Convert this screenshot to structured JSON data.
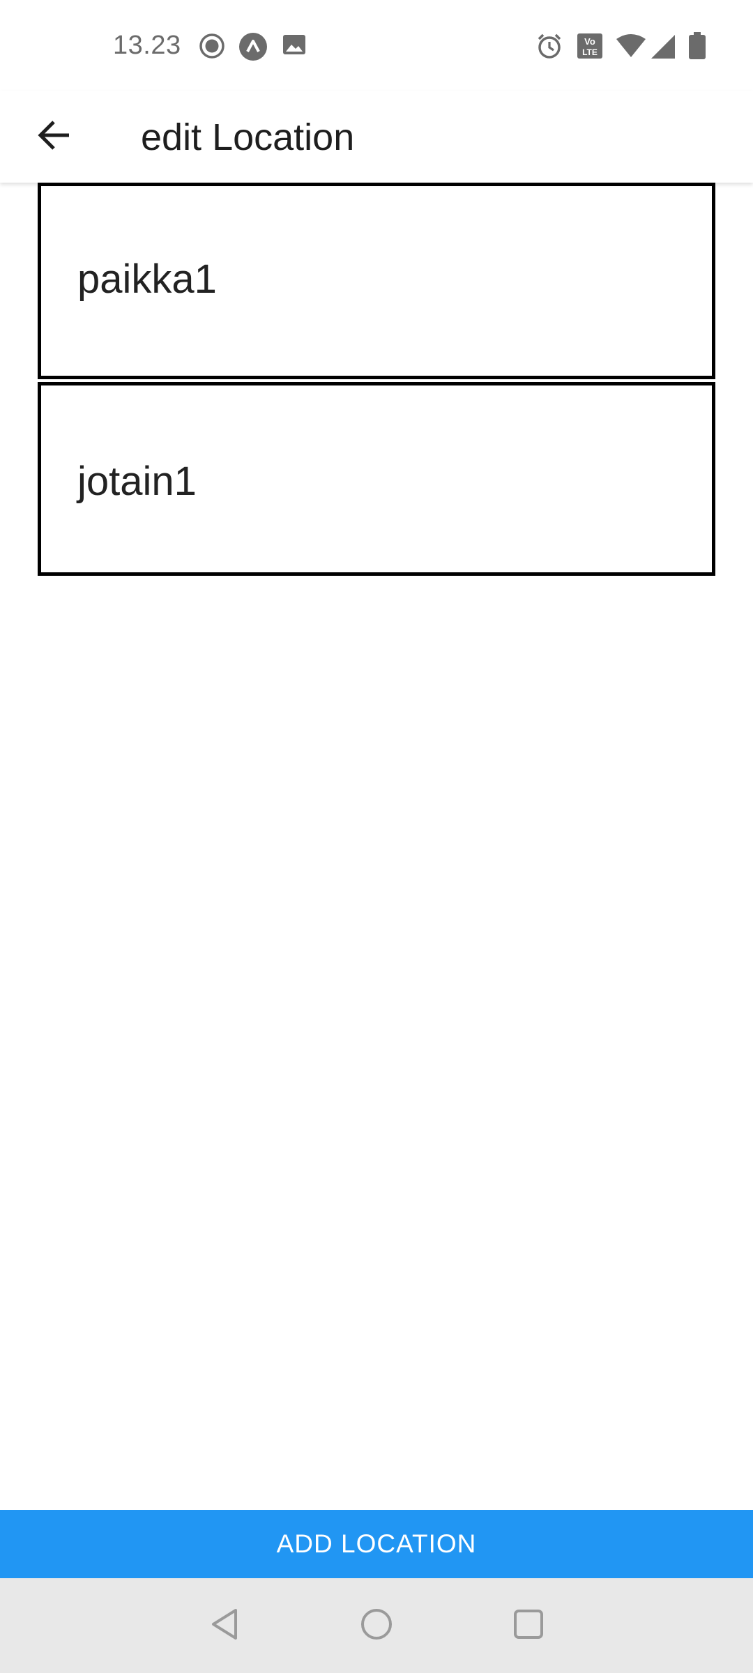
{
  "status_bar": {
    "time": "13.23",
    "left_icons": [
      "record-icon",
      "app-icon",
      "image-icon"
    ],
    "right_icons": [
      "alarm-icon",
      "volte-icon",
      "wifi-icon",
      "signal-icon",
      "battery-icon"
    ],
    "volte_top": "Vo",
    "volte_bottom": "LTE"
  },
  "app_bar": {
    "title": "edit Location",
    "back_icon": "arrow-left-icon"
  },
  "locations": [
    {
      "label": "paikka1"
    },
    {
      "label": "jotain1"
    }
  ],
  "add_button": {
    "label": "ADD LOCATION",
    "color": "#2196f3"
  },
  "nav_bar": {
    "buttons": [
      "back-triangle-icon",
      "home-circle-icon",
      "recents-square-icon"
    ]
  }
}
